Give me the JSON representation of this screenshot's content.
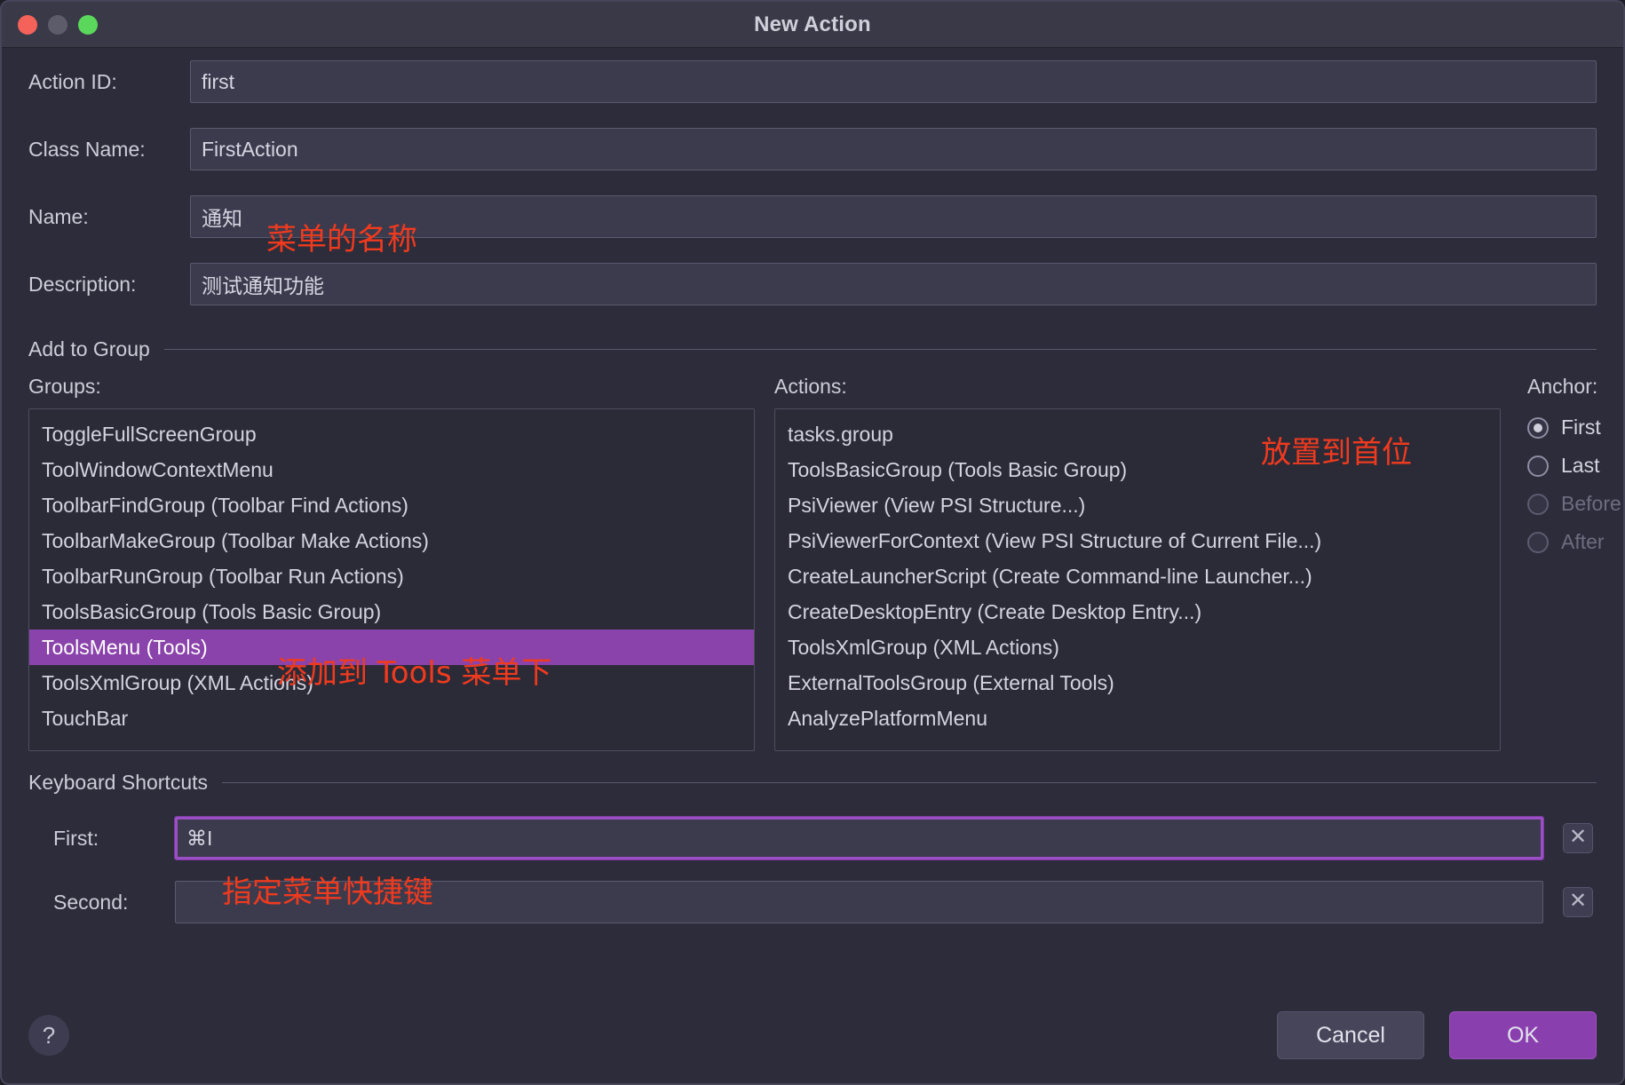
{
  "window": {
    "title": "New Action",
    "traffic_lights": [
      "close-light",
      "minimize-light",
      "zoom-light"
    ]
  },
  "form": {
    "fields": [
      {
        "label": "Action ID:",
        "value": "first"
      },
      {
        "label": "Class Name:",
        "value": "FirstAction"
      },
      {
        "label": "Name:",
        "value": "通知"
      },
      {
        "label": "Description:",
        "value": "测试通知功能"
      }
    ]
  },
  "add_to_group": {
    "section_title": "Add to Group",
    "groups_caption": "Groups:",
    "actions_caption": "Actions:",
    "groups": [
      {
        "label": "ToggleFullScreenGroup",
        "selected": false
      },
      {
        "label": "ToolWindowContextMenu",
        "selected": false
      },
      {
        "label": "ToolbarFindGroup (Toolbar Find Actions)",
        "selected": false
      },
      {
        "label": "ToolbarMakeGroup (Toolbar Make Actions)",
        "selected": false
      },
      {
        "label": "ToolbarRunGroup (Toolbar Run Actions)",
        "selected": false
      },
      {
        "label": "ToolsBasicGroup (Tools Basic Group)",
        "selected": false
      },
      {
        "label": "ToolsMenu (Tools)",
        "selected": true
      },
      {
        "label": "ToolsXmlGroup (XML Actions)",
        "selected": false
      },
      {
        "label": "TouchBar",
        "selected": false
      }
    ],
    "actions": [
      {
        "label": "tasks.group"
      },
      {
        "label": "ToolsBasicGroup (Tools Basic Group)"
      },
      {
        "label": "PsiViewer (View PSI Structure...)"
      },
      {
        "label": "PsiViewerForContext (View PSI Structure of Current File...)"
      },
      {
        "label": "CreateLauncherScript (Create Command-line Launcher...)"
      },
      {
        "label": "CreateDesktopEntry (Create Desktop Entry...)"
      },
      {
        "label": "ToolsXmlGroup (XML Actions)"
      },
      {
        "label": "ExternalToolsGroup (External Tools)"
      },
      {
        "label": "AnalyzePlatformMenu"
      }
    ],
    "anchor": {
      "caption": "Anchor:",
      "options": [
        {
          "label": "First",
          "checked": true,
          "disabled": false
        },
        {
          "label": "Last",
          "checked": false,
          "disabled": false
        },
        {
          "label": "Before",
          "checked": false,
          "disabled": true
        },
        {
          "label": "After",
          "checked": false,
          "disabled": true
        }
      ]
    }
  },
  "keyboard_shortcuts": {
    "section_title": "Keyboard Shortcuts",
    "first": {
      "label": "First:",
      "value": "⌘I",
      "focused": true,
      "clear_glyph": "✕"
    },
    "second": {
      "label": "Second:",
      "value": "",
      "focused": false,
      "clear_glyph": "✕"
    }
  },
  "footer": {
    "help_glyph": "?",
    "cancel_label": "Cancel",
    "ok_label": "OK"
  },
  "annotations": [
    {
      "id": "annot-name",
      "text": "菜单的名称"
    },
    {
      "id": "annot-group",
      "text": "添加到 Tools 菜单下"
    },
    {
      "id": "annot-anchor",
      "text": "放置到首位"
    },
    {
      "id": "annot-shortcut",
      "text": "指定菜单快捷键"
    }
  ],
  "colors": {
    "dialog_background": "#2d2c3a",
    "titlebar": "#3a3948",
    "input_background": "#3c3b4d",
    "list_background": "#2b2b38",
    "selection_purple": "#8a43ab",
    "accent_purple": "#8a3fae",
    "focus_purple": "#9b4fc4",
    "annotation_red": "#f03a1e",
    "text_primary": "#d4d3df",
    "text_disabled": "#6e6d80"
  }
}
